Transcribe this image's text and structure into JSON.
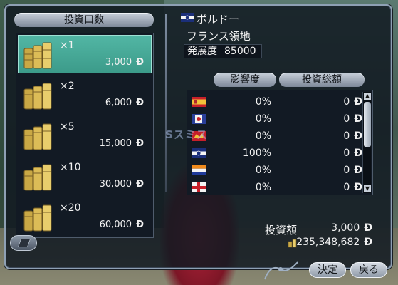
{
  "left_panel": {
    "header": "投資口数",
    "currency_symbol": "Ð",
    "items": [
      {
        "multiplier": "×1",
        "amount": "3,000",
        "selected": true
      },
      {
        "multiplier": "×2",
        "amount": "6,000",
        "selected": false
      },
      {
        "multiplier": "×5",
        "amount": "15,000",
        "selected": false
      },
      {
        "multiplier": "×10",
        "amount": "30,000",
        "selected": false
      },
      {
        "multiplier": "×20",
        "amount": "60,000",
        "selected": false
      }
    ]
  },
  "city": {
    "name": "ボルドー",
    "owner": "フランス領地",
    "development_label": "発展度",
    "development_value": "85000"
  },
  "table": {
    "influence_header": "影響度",
    "investment_header": "投資総額",
    "currency_symbol": "Ð",
    "rows": [
      {
        "flag": "flag-icon-1",
        "influence": "0%",
        "investment": "0"
      },
      {
        "flag": "flag-icon-2",
        "influence": "0%",
        "investment": "0"
      },
      {
        "flag": "flag-icon-3",
        "influence": "0%",
        "investment": "0"
      },
      {
        "flag": "flag-icon-4",
        "influence": "100%",
        "investment": "0"
      },
      {
        "flag": "flag-icon-5",
        "influence": "0%",
        "investment": "0"
      },
      {
        "flag": "flag-icon-6",
        "influence": "0%",
        "investment": "0"
      }
    ]
  },
  "overlay_text": "Sスミス",
  "footer": {
    "investment_label": "投資額",
    "investment_value": "3,000",
    "funds_value": "235,348,682",
    "currency_symbol": "Ð"
  },
  "buttons": {
    "decide": "決定",
    "back": "戻る"
  },
  "colors": {
    "selected_bg": "#3c9b8a",
    "panel_bg": "#121a24",
    "button_face": "#c8d0da"
  }
}
